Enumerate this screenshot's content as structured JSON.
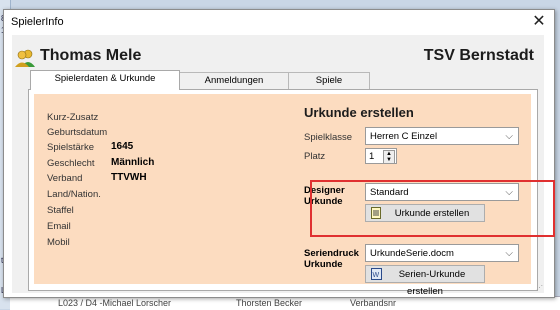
{
  "window": {
    "title": "SpielerInfo"
  },
  "player": {
    "name": "Thomas Mele",
    "club": "TSV Bernstadt"
  },
  "tabs": [
    {
      "label": "Spielerdaten & Urkunde",
      "active": true
    },
    {
      "label": "Anmeldungen",
      "active": false
    },
    {
      "label": "Spiele",
      "active": false
    }
  ],
  "details": {
    "kurz_zusatz": {
      "label": "Kurz-Zusatz",
      "value": ""
    },
    "geburtsdatum": {
      "label": "Geburtsdatum",
      "value": ""
    },
    "spielstaerke": {
      "label": "Spielstärke",
      "value": "1645"
    },
    "geschlecht": {
      "label": "Geschlecht",
      "value": "Männlich"
    },
    "verband": {
      "label": "Verband",
      "value": "TTVWH"
    },
    "land": {
      "label": "Land/Nation.",
      "value": ""
    },
    "staffel": {
      "label": "Staffel",
      "value": ""
    },
    "email": {
      "label": "Email",
      "value": ""
    },
    "mobil": {
      "label": "Mobil",
      "value": ""
    }
  },
  "urkunde": {
    "title": "Urkunde erstellen",
    "spielklasse_label": "Spielklasse",
    "spielklasse_value": "Herren C Einzel",
    "platz_label": "Platz",
    "platz_value": "1",
    "designer_label": "Designer Urkunde",
    "designer_value": "Standard",
    "create_button": "Urkunde erstellen",
    "seriendruck_label": "Seriendruck Urkunde",
    "seriendruck_value": "UrkundeSerie.docm",
    "serien_button": "Serien-Urkunde erstellen"
  },
  "background": {
    "row_text": [
      "L023 / D4 -Michael Lorscher",
      "Thorsten Becker",
      "Verbandsnr"
    ]
  },
  "colors": {
    "panel_fill": "#fcdcc0",
    "highlight": "#e03030"
  }
}
